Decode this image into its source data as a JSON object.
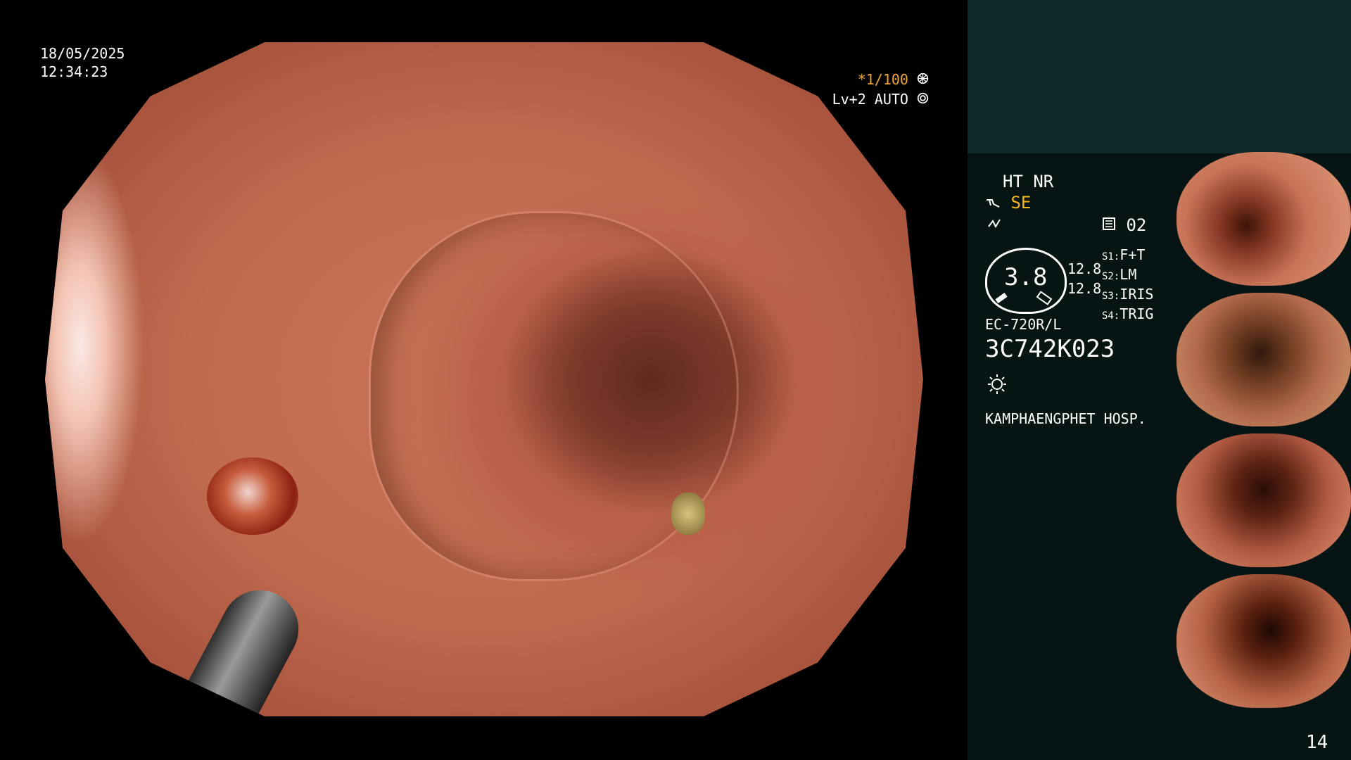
{
  "overlay": {
    "date": "18/05/2025",
    "time": "12:34:23",
    "shutter": "*1/100",
    "level": "Lv+2 AUTO"
  },
  "sidebar": {
    "enhancement": "HT NR",
    "structure_mode": "SE",
    "channel_label": "02",
    "gauge_value": "3.8",
    "values": [
      "12.8",
      "12.8"
    ],
    "settings": [
      {
        "slot": "S1",
        "value": "F+T"
      },
      {
        "slot": "S2",
        "value": "LM"
      },
      {
        "slot": "S3",
        "value": "IRIS"
      },
      {
        "slot": "S4",
        "value": "TRIG"
      }
    ],
    "scope_model": "EC-720R/L",
    "serial": "3C742K023",
    "hospital": "KAMPHAENGPHET HOSP.",
    "thumbnail_caption": "3C742K023"
  },
  "page_number": "14",
  "icons": {
    "shutter": "aperture-icon",
    "level": "ring-icon",
    "mode": "scope-arm-icon",
    "flash": "zigzag-icon",
    "memory": "memory-card-icon",
    "light": "light-icon"
  }
}
